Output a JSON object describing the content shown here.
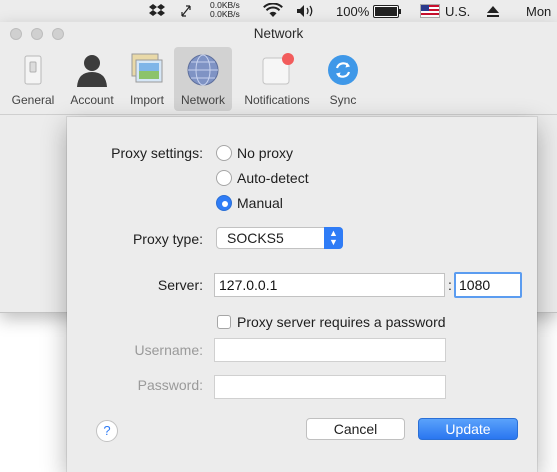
{
  "menubar": {
    "net_up": "0.0KB/s",
    "net_down": "0.0KB/s",
    "battery": "100%",
    "input_source": "U.S.",
    "clock_partial": "Mon",
    "icons": [
      "dropbox-icon",
      "arrows-icon",
      "wifi-icon",
      "volume-icon",
      "battery-icon",
      "flag-icon",
      "eject-icon"
    ]
  },
  "window": {
    "title": "Network",
    "toolbar": [
      {
        "label": "General",
        "icon": "switch-icon"
      },
      {
        "label": "Account",
        "icon": "person-icon"
      },
      {
        "label": "Import",
        "icon": "photos-icon"
      },
      {
        "label": "Network",
        "icon": "globe-icon",
        "active": true
      },
      {
        "label": "Notifications",
        "icon": "notification-icon"
      },
      {
        "label": "Sync",
        "icon": "sync-icon"
      }
    ]
  },
  "dialog": {
    "proxy_settings_label": "Proxy settings:",
    "options": [
      {
        "label": "No proxy",
        "selected": false
      },
      {
        "label": "Auto-detect",
        "selected": false
      },
      {
        "label": "Manual",
        "selected": true
      }
    ],
    "proxy_type_label": "Proxy type:",
    "proxy_type_value": "SOCKS5",
    "server_label": "Server:",
    "server_value": "127.0.0.1",
    "port_separator": ":",
    "port_value": "1080",
    "requires_password_label": "Proxy server requires a password",
    "requires_password_checked": false,
    "username_label": "Username:",
    "username_value": "",
    "password_label": "Password:",
    "password_value": "",
    "help_label": "?",
    "cancel_label": "Cancel",
    "update_label": "Update"
  },
  "colors": {
    "accent": "#2f7cf6",
    "window_bg": "#ececec"
  }
}
